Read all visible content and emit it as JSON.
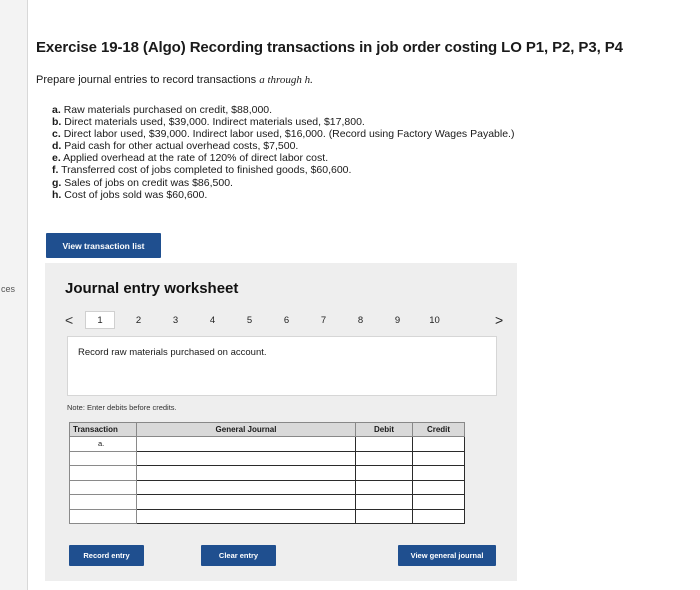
{
  "side_label": "ces",
  "title": "Exercise 19-18 (Algo) Recording transactions in job order costing LO P1, P2, P3, P4",
  "instructions": {
    "prefix": "Prepare journal entries to record transactions",
    "range": "a through h."
  },
  "transactions": [
    {
      "letter": "a.",
      "text": "Raw materials purchased on credit, $88,000."
    },
    {
      "letter": "b.",
      "text": "Direct materials used, $39,000. Indirect materials used, $17,800."
    },
    {
      "letter": "c.",
      "text": "Direct labor used, $39,000. Indirect labor used, $16,000. (Record using Factory Wages Payable.)"
    },
    {
      "letter": "d.",
      "text": "Paid cash for other actual overhead costs, $7,500."
    },
    {
      "letter": "e.",
      "text": "Applied overhead at the rate of 120% of direct labor cost."
    },
    {
      "letter": "f.",
      "text": "Transferred cost of jobs completed to finished goods, $60,600."
    },
    {
      "letter": "g.",
      "text": "Sales of jobs on credit was $86,500."
    },
    {
      "letter": "h.",
      "text": "Cost of jobs sold was $60,600."
    }
  ],
  "buttons": {
    "view_transaction_list": "View transaction list",
    "record_entry": "Record entry",
    "clear_entry": "Clear entry",
    "view_general_journal": "View general journal"
  },
  "worksheet": {
    "title": "Journal entry worksheet",
    "pager": {
      "prev": "<",
      "next": ">",
      "pages": [
        "1",
        "2",
        "3",
        "4",
        "5",
        "6",
        "7",
        "8",
        "9",
        "10"
      ],
      "active": "1"
    },
    "description": "Record raw materials purchased on account.",
    "note": "Note: Enter debits before credits.",
    "table": {
      "headers": {
        "transaction": "Transaction",
        "general_journal": "General Journal",
        "debit": "Debit",
        "credit": "Credit"
      },
      "rows": [
        {
          "transaction": "a.",
          "account": "",
          "debit": "",
          "credit": ""
        },
        {
          "transaction": "",
          "account": "",
          "debit": "",
          "credit": ""
        },
        {
          "transaction": "",
          "account": "",
          "debit": "",
          "credit": ""
        },
        {
          "transaction": "",
          "account": "",
          "debit": "",
          "credit": ""
        },
        {
          "transaction": "",
          "account": "",
          "debit": "",
          "credit": ""
        },
        {
          "transaction": "",
          "account": "",
          "debit": "",
          "credit": ""
        }
      ]
    }
  },
  "colors": {
    "button": "#1f4f8f",
    "panel": "#eeeeee",
    "header": "#d9d9d9"
  }
}
